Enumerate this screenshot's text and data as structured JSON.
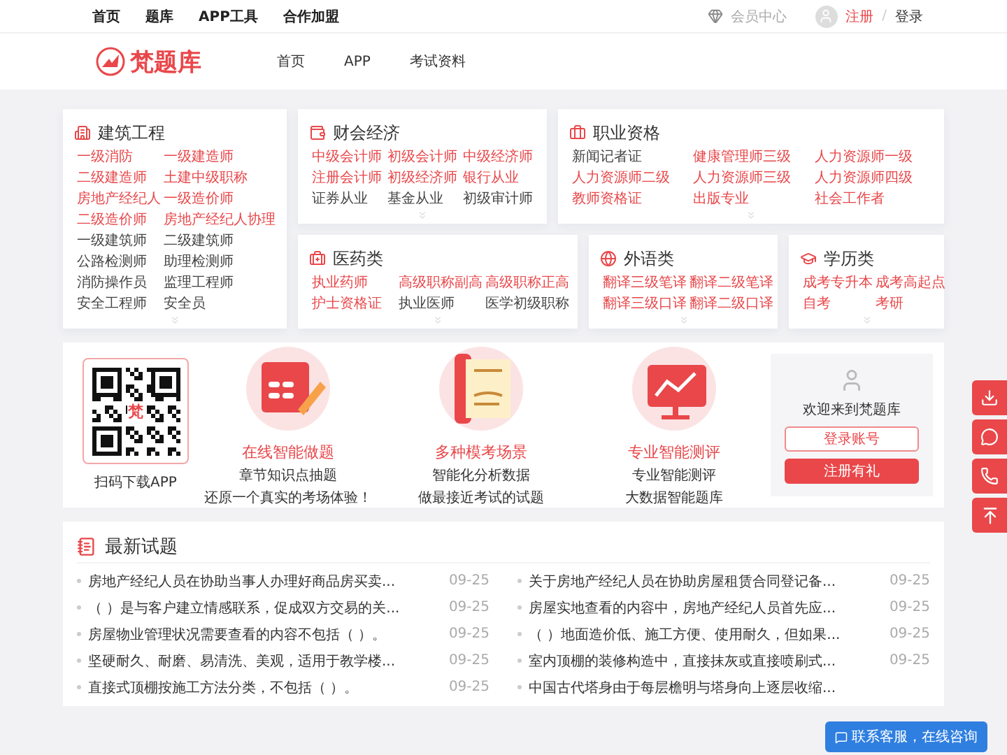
{
  "top_bar": {
    "links": [
      {
        "label": "首页"
      },
      {
        "label": "题库"
      },
      {
        "label": "APP工具"
      },
      {
        "label": "合作加盟"
      }
    ],
    "member_center": "会员中心",
    "register": "注册",
    "separator": "/",
    "login": "登录"
  },
  "header": {
    "logo_text": "梵题库",
    "nav": [
      {
        "label": "首页"
      },
      {
        "label": "APP"
      },
      {
        "label": "考试资料"
      }
    ]
  },
  "categories": [
    {
      "kind": "building",
      "title": "建筑工程",
      "items": [
        {
          "label": "一级消防",
          "hot": true
        },
        {
          "label": "一级建造师",
          "hot": true
        },
        {
          "label": "二级建造师",
          "hot": true
        },
        {
          "label": "土建中级职称",
          "hot": true
        },
        {
          "label": "房地产经纪人",
          "hot": true
        },
        {
          "label": "一级造价师",
          "hot": true
        },
        {
          "label": "二级造价师",
          "hot": true
        },
        {
          "label": "房地产经纪人协理",
          "hot": true
        },
        {
          "label": "一级建筑师",
          "hot": false
        },
        {
          "label": "二级建筑师",
          "hot": false
        },
        {
          "label": "公路检测师",
          "hot": false
        },
        {
          "label": "助理检测师",
          "hot": false
        },
        {
          "label": "消防操作员",
          "hot": false
        },
        {
          "label": "监理工程师",
          "hot": false
        },
        {
          "label": "安全工程师",
          "hot": false
        },
        {
          "label": "安全员",
          "hot": false
        }
      ]
    },
    {
      "kind": "finance",
      "title": "财会经济",
      "items": [
        {
          "label": "中级会计师",
          "hot": true
        },
        {
          "label": "初级会计师",
          "hot": true
        },
        {
          "label": "中级经济师",
          "hot": true
        },
        {
          "label": "注册会计师",
          "hot": true
        },
        {
          "label": "初级经济师",
          "hot": true
        },
        {
          "label": "银行从业",
          "hot": true
        },
        {
          "label": "证券从业",
          "hot": false
        },
        {
          "label": "基金从业",
          "hot": false
        },
        {
          "label": "初级审计师",
          "hot": false
        }
      ]
    },
    {
      "kind": "career",
      "title": "职业资格",
      "items": [
        {
          "label": "新闻记者证",
          "hot": false
        },
        {
          "label": "健康管理师三级",
          "hot": true
        },
        {
          "label": "人力资源师一级",
          "hot": true
        },
        {
          "label": "人力资源师二级",
          "hot": true
        },
        {
          "label": "人力资源师三级",
          "hot": true
        },
        {
          "label": "人力资源师四级",
          "hot": true
        },
        {
          "label": "教师资格证",
          "hot": true
        },
        {
          "label": "出版专业",
          "hot": true
        },
        {
          "label": "社会工作者",
          "hot": true
        }
      ]
    },
    {
      "kind": "medical",
      "title": "医药类",
      "items": [
        {
          "label": "执业药师",
          "hot": true
        },
        {
          "label": "高级职称副高",
          "hot": true
        },
        {
          "label": "高级职称正高",
          "hot": true
        },
        {
          "label": "护士资格证",
          "hot": true
        },
        {
          "label": "执业医师",
          "hot": false
        },
        {
          "label": "医学初级职称",
          "hot": false
        }
      ]
    },
    {
      "kind": "language",
      "title": "外语类",
      "items": [
        {
          "label": "翻译三级笔译",
          "hot": true
        },
        {
          "label": "翻译二级笔译",
          "hot": true
        },
        {
          "label": "翻译三级口译",
          "hot": true
        },
        {
          "label": "翻译二级口译",
          "hot": true
        }
      ]
    },
    {
      "kind": "education",
      "title": "学历类",
      "items": [
        {
          "label": "成考专升本",
          "hot": true
        },
        {
          "label": "成考高起点",
          "hot": true
        },
        {
          "label": "自考",
          "hot": true
        },
        {
          "label": "考研",
          "hot": true
        }
      ]
    }
  ],
  "promo": {
    "qr_mark": "梵",
    "qr_caption": "扫码下载APP",
    "features": [
      {
        "kind": "practice",
        "title": "在线智能做题",
        "lines": [
          "章节知识点抽题",
          "还原一个真实的考场体验！"
        ]
      },
      {
        "kind": "mock",
        "title": "多种模考场景",
        "lines": [
          "智能化分析数据",
          "做最接近考试的试题"
        ]
      },
      {
        "kind": "report",
        "title": "专业智能测评",
        "lines": [
          "专业智能测评",
          "大数据智能题库"
        ]
      }
    ],
    "welcome": "欢迎来到梵题库",
    "login_button": "登录账号",
    "register_button": "注册有礼"
  },
  "latest": {
    "title": "最新试题",
    "columns": [
      [
        {
          "text": "房地产经纪人员在协助当事人办理好商品房买卖...",
          "date": "09-25"
        },
        {
          "text": "（ ）是与客户建立情感联系，促成双方交易的关...",
          "date": "09-25"
        },
        {
          "text": "房屋物业管理状况需要查看的内容不包括（ ）。",
          "date": "09-25"
        },
        {
          "text": "坚硬耐久、耐磨、易清洗、美观，适用于教学楼...",
          "date": "09-25"
        },
        {
          "text": "直接式顶棚按施工方法分类，不包括（ ）。",
          "date": "09-25"
        }
      ],
      [
        {
          "text": "关于房地产经纪人员在协助房屋租赁合同登记备...",
          "date": "09-25"
        },
        {
          "text": "房屋实地查看的内容中，房地产经纪人员首先应...",
          "date": "09-25"
        },
        {
          "text": "（ ）地面造价低、施工方便、使用耐久，但如果...",
          "date": "09-25"
        },
        {
          "text": "室内顶棚的装修构造中，直接抹灰或直接喷刷式...",
          "date": "09-25"
        },
        {
          "text": "中国古代塔身由于每层檐明与塔身向上逐层收缩..."
        }
      ]
    ]
  },
  "side_tools": [
    {
      "kind": "download"
    },
    {
      "kind": "chat"
    },
    {
      "kind": "phone"
    },
    {
      "kind": "top"
    }
  ],
  "service_button": "联系客服，在线咨询"
}
